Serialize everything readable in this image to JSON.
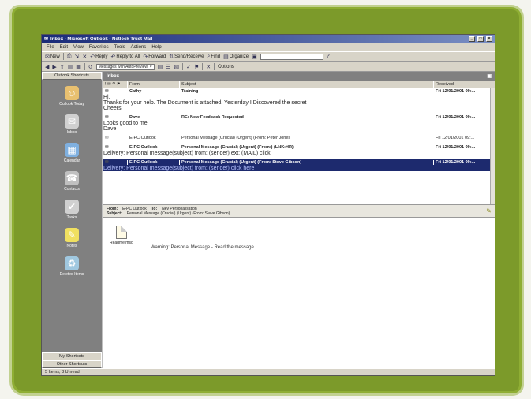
{
  "window": {
    "title": "Inbox - Microsoft Outlook - Netlock Trust Mail"
  },
  "menu": [
    "File",
    "Edit",
    "View",
    "Favorites",
    "Tools",
    "Actions",
    "Help"
  ],
  "toolbar": {
    "new_label": "New",
    "reply_label": "Reply",
    "reply_all_label": "Reply to All",
    "forward_label": "Forward",
    "send_receive_label": "Send/Receive",
    "find_label": "Find",
    "organize_label": "Organize",
    "type_contact_label": "Type a contact",
    "address_select": "Messages with AutoPreview",
    "options_label": "Options"
  },
  "outlook_bar": {
    "header": "Outlook Shortcuts",
    "items": [
      {
        "label": "Outlook Today",
        "icon": "outlook-today-icon",
        "glyph": "☺",
        "color": "#e8c070"
      },
      {
        "label": "Inbox",
        "icon": "inbox-icon",
        "glyph": "✉",
        "color": "#d0d0d0"
      },
      {
        "label": "Calendar",
        "icon": "calendar-icon",
        "glyph": "▦",
        "color": "#7fb0e0"
      },
      {
        "label": "Contacts",
        "icon": "contacts-icon",
        "glyph": "☎",
        "color": "#c0c0c0"
      },
      {
        "label": "Tasks",
        "icon": "tasks-icon",
        "glyph": "✔",
        "color": "#d0d0d0"
      },
      {
        "label": "Notes",
        "icon": "notes-icon",
        "glyph": "✎",
        "color": "#f0e060"
      },
      {
        "label": "Deleted Items",
        "icon": "deleted-items-icon",
        "glyph": "♻",
        "color": "#a0c8e0"
      }
    ],
    "my_shortcuts": "My Shortcuts",
    "other_shortcuts": "Other Shortcuts"
  },
  "folder": {
    "name": "Inbox"
  },
  "columns": {
    "from": "From",
    "subject": "Subject",
    "received": "Received"
  },
  "messages": [
    {
      "from": "Cathy",
      "subject": "Training",
      "received": "Fri 12/01/2001 09:...",
      "preview1": "Hi,",
      "preview2": "Thanks for your help. The Document is attached. Yesterday I Discovered the secret",
      "preview3": "Cheers",
      "bold": true,
      "selected": false
    },
    {
      "from": "Dave",
      "subject": "RE: New Feedback Requested",
      "received": "Fri 12/01/2001 09:...",
      "preview1": "Looks good to me",
      "preview2": "Dave",
      "preview3": "",
      "bold": true,
      "selected": false
    },
    {
      "from": "E-PC Outlook",
      "subject": "Personal Message (Crucial) (Urgent) (From: Peter Jones",
      "received": "Fri 12/01/2001 09:...",
      "preview1": "",
      "preview2": "",
      "preview3": "",
      "bold": false,
      "selected": false
    },
    {
      "from": "E-PC Outlook",
      "subject": "Personal Message (Crucial) (Urgent) (From:) (LNK:HR)",
      "received": "Fri 12/01/2001 09:...",
      "preview1": "Delivery: Personal message(subject) from: (sender) ext: (MAIL) click",
      "preview2": "",
      "preview3": "",
      "bold": true,
      "selected": false
    },
    {
      "from": "E-PC Outlook",
      "subject": "Personal Message (Crucial) (Urgent) (From: Steve Gibson)",
      "received": "Fri 12/01/2001 09:...",
      "preview1": "Delivery: Personal message(subject) from: (sender) click here",
      "preview2": "",
      "preview3": "",
      "bold": true,
      "selected": true
    }
  ],
  "preview": {
    "from_label": "From:",
    "from_value": "E-PC Outlook",
    "to_label": "To:",
    "to_value": "Nev Personalisation",
    "subject_label": "Subject:",
    "subject_value": "Personal Message (Crucial) (Urgent) (From: Steve Gibson)",
    "attachment_name": "Readme.msg",
    "body_text": "Warning: Personal Message - Read the message"
  },
  "status": {
    "text": "5 Items, 3 Unread"
  }
}
